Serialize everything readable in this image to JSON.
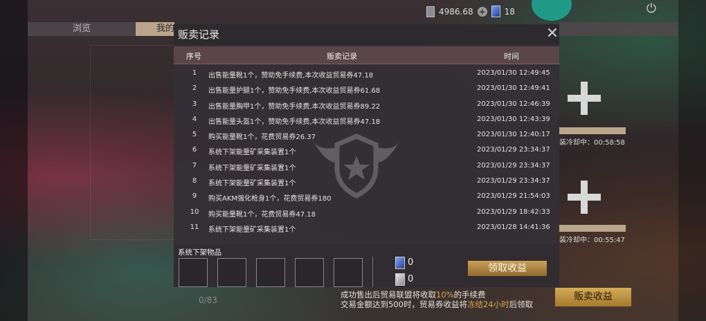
{
  "topbar": {
    "currency_value": "4986.68",
    "card_count": "18"
  },
  "tabs": {
    "browse": "浏览",
    "mine": "我的"
  },
  "modal": {
    "title": "贩卖记录",
    "columns": [
      "序号",
      "贩卖记录",
      "时间"
    ],
    "rows": [
      {
        "idx": "1",
        "record": "出售能量靴1个，赞助免手续费,本次收益贸易券47.18",
        "time": "2023/01/30 12:49:45"
      },
      {
        "idx": "2",
        "record": "出售能量护腿1个，赞助免手续费,本次收益贸易券61.68",
        "time": "2023/01/30 12:49:41"
      },
      {
        "idx": "3",
        "record": "出售能量胸甲1个，赞助免手续费,本次收益贸易券89.22",
        "time": "2023/01/30 12:46:39"
      },
      {
        "idx": "4",
        "record": "出售能量头盔1个，赞助免手续费,本次收益贸易券47.18",
        "time": "2023/01/30 12:43:39"
      },
      {
        "idx": "5",
        "record": "购买能量靴1个，花费贸易券26.37",
        "time": "2023/01/30 12:40:17"
      },
      {
        "idx": "6",
        "record": "系统下架能量矿采集装置1个",
        "time": "2023/01/29 23:34:37"
      },
      {
        "idx": "7",
        "record": "系统下架能量矿采集装置1个",
        "time": "2023/01/29 23:34:37"
      },
      {
        "idx": "8",
        "record": "系统下架能量矿采集装置1个",
        "time": "2023/01/29 23:34:37"
      },
      {
        "idx": "9",
        "record": "购买AKM强化枪身1个，花费贸易券180",
        "time": "2023/01/29 21:54:03"
      },
      {
        "idx": "10",
        "record": "购买能量靴1个，花费贸易券47.18",
        "time": "2023/01/29 18:42:33"
      },
      {
        "idx": "11",
        "record": "系统下架能量矿采集装置1个",
        "time": "2023/01/28 14:41:36"
      }
    ],
    "footer_title": "系统下架物品",
    "res_card_value": "0",
    "res_paper_value": "0",
    "claim_label": "领取收益"
  },
  "right_panel": {
    "cooldown_1": "装冷却中：00:58:58",
    "cooldown_2": "装冷却中：00:55:47",
    "sell_earnings_label": "贩卖收益"
  },
  "bottom": {
    "count": "0/83",
    "fee_1_pre": "成功售出后贸易联盟将收取",
    "fee_1_hl": "10%",
    "fee_1_post": "的手续费",
    "fee_2_pre": "交易金额达到500时，贸易券收益将",
    "fee_2_hl": "冻结24小时",
    "fee_2_post": "后领取"
  }
}
